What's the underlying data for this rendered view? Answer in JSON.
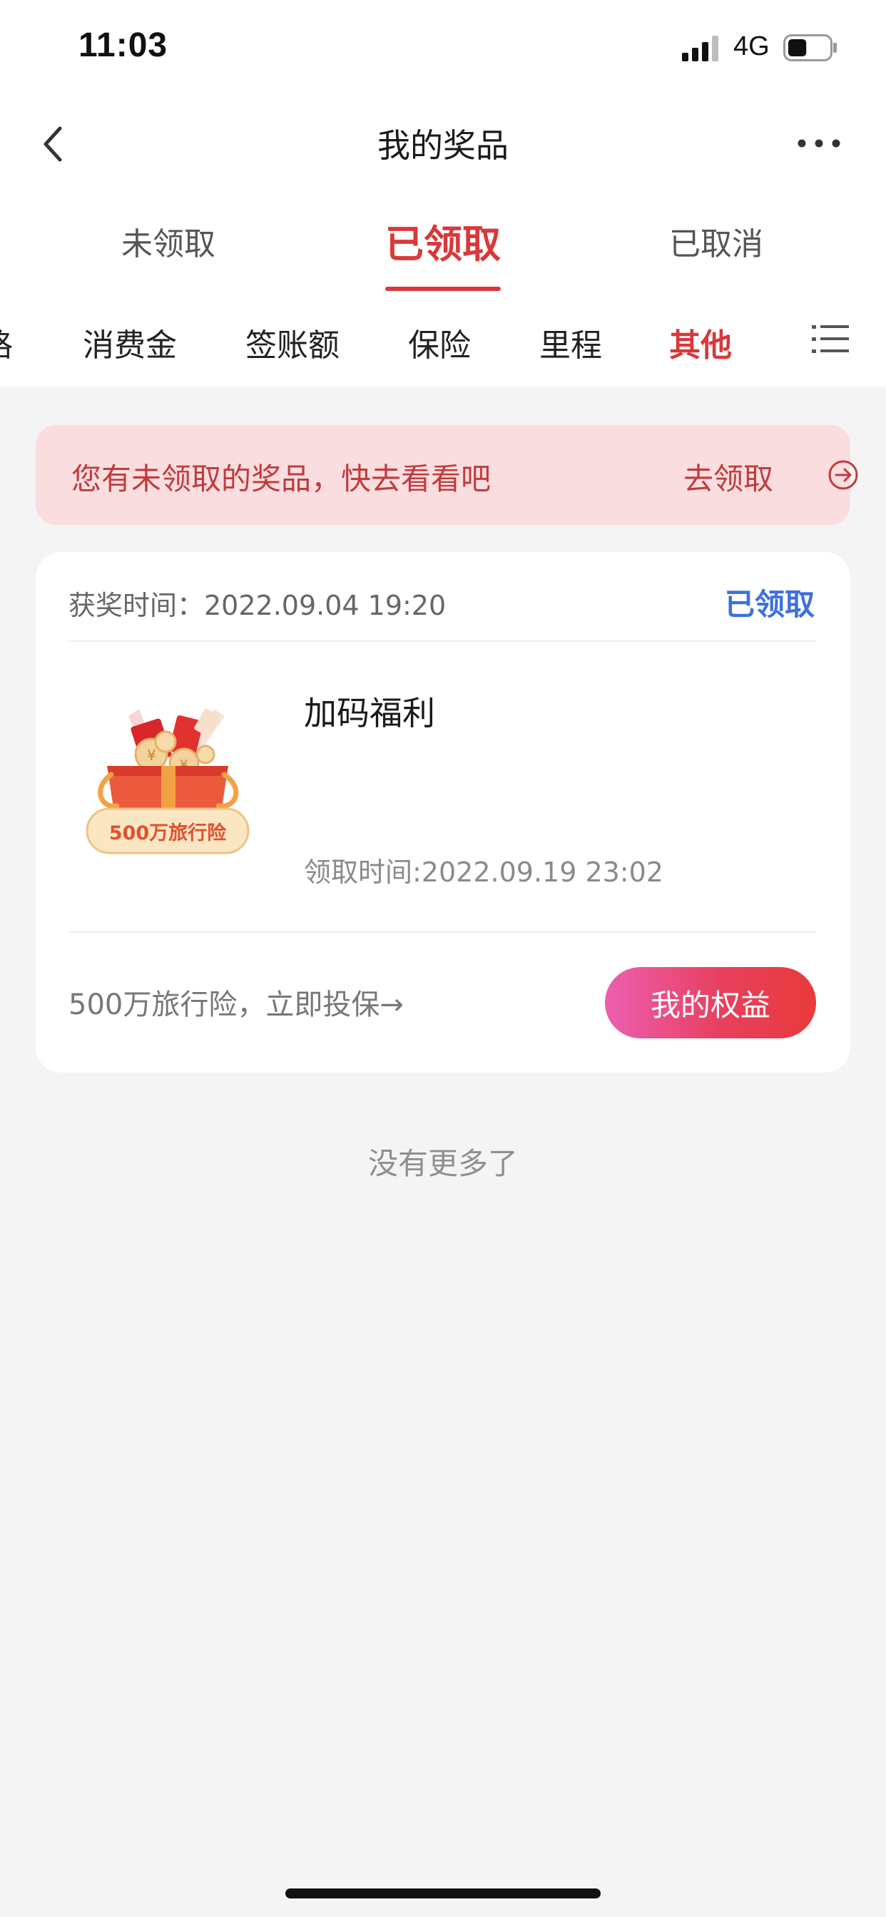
{
  "status_bar": {
    "time": "11:03",
    "network": "4G",
    "battery_level": 0.45
  },
  "nav": {
    "title": "我的奖品",
    "back_icon": "chevron-left-icon",
    "more_icon": "more-dots-icon"
  },
  "main_tabs": [
    {
      "label": "未领取",
      "active": false
    },
    {
      "label": "已领取",
      "active": true
    },
    {
      "label": "已取消",
      "active": false
    }
  ],
  "category_tabs": [
    {
      "label": "格",
      "active": false
    },
    {
      "label": "消费金",
      "active": false
    },
    {
      "label": "签账额",
      "active": false
    },
    {
      "label": "保险",
      "active": false
    },
    {
      "label": "里程",
      "active": false
    },
    {
      "label": "其他",
      "active": true
    }
  ],
  "notice": {
    "text": "您有未领取的奖品，快去看看吧",
    "link": "去领取"
  },
  "prize_card": {
    "award_time": "获奖时间：2022.09.04 19:20",
    "status": "已领取",
    "image_label": "500万旅行险",
    "name": "加码福利",
    "claimed_time": "领取时间:2022.09.19 23:02",
    "footer_text": "500万旅行险，立即投保→",
    "button_label": "我的权益"
  },
  "no_more": "没有更多了",
  "colors": {
    "accent_red": "#d9383a",
    "link_blue": "#3d6fde",
    "notice_bg": "#fadedf"
  }
}
